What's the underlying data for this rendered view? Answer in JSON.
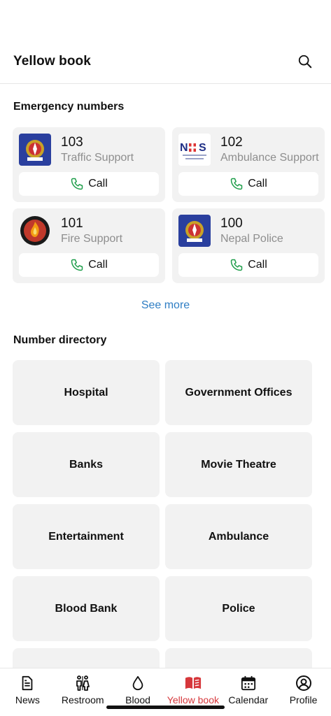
{
  "header": {
    "title": "Yellow book"
  },
  "emergency": {
    "section_title": "Emergency numbers",
    "cards": [
      {
        "number": "103",
        "label": "Traffic Support",
        "call_label": "Call"
      },
      {
        "number": "102",
        "label": "Ambulance Support",
        "call_label": "Call"
      },
      {
        "number": "101",
        "label": "Fire Support",
        "call_label": "Call"
      },
      {
        "number": "100",
        "label": "Nepal Police",
        "call_label": "Call"
      }
    ],
    "see_more": "See more"
  },
  "directory": {
    "section_title": "Number directory",
    "items": [
      "Hospital",
      "Government Offices",
      "Banks",
      "Movie Theatre",
      "Entertainment",
      "Ambulance",
      "Blood Bank",
      "Police",
      "",
      ""
    ]
  },
  "nav": {
    "items": [
      {
        "label": "News",
        "icon": "news-icon"
      },
      {
        "label": "Restroom",
        "icon": "restroom-icon"
      },
      {
        "label": "Blood",
        "icon": "blood-drop-icon"
      },
      {
        "label": "Yellow book",
        "icon": "book-icon"
      },
      {
        "label": "Calendar",
        "icon": "calendar-icon"
      },
      {
        "label": "Profile",
        "icon": "profile-icon"
      }
    ],
    "active": "Yellow book"
  },
  "colors": {
    "accent": "#d6373b",
    "link": "#2f7ec4",
    "call_icon": "#1e9e4a",
    "card_bg": "#f2f2f2"
  }
}
